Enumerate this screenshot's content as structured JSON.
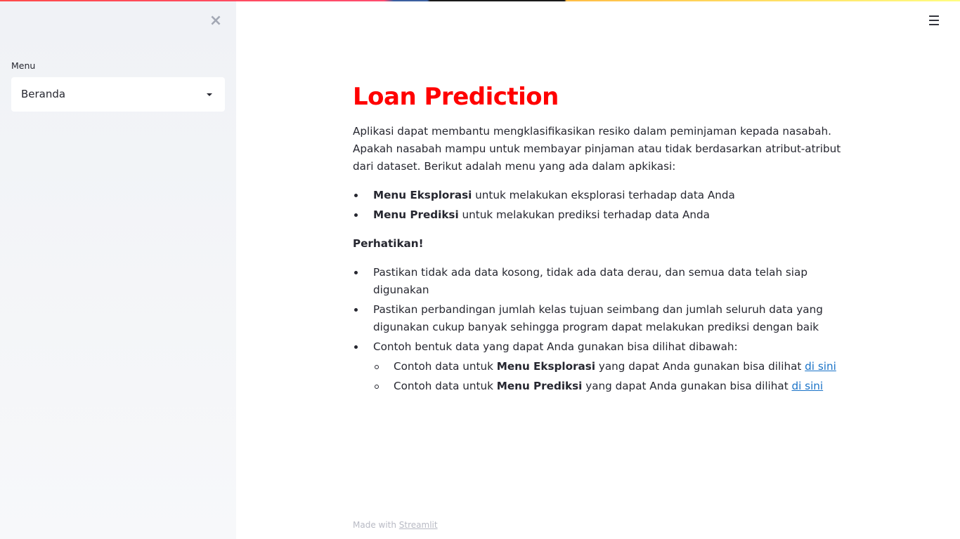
{
  "sidebar": {
    "close_glyph": "×",
    "menu_label": "Menu",
    "select_value": "Beranda"
  },
  "header": {
    "menu_glyph": "☰"
  },
  "main": {
    "title": "Loan Prediction",
    "intro": "Aplikasi dapat membantu mengklasifikasikan resiko dalam peminjaman kepada nasabah. Apakah nasabah mampu untuk membayar pinjaman atau tidak berdasarkan atribut-atribut dari dataset. Berikut adalah menu yang ada dalam apkikasi:",
    "menu_items": [
      {
        "bold": "Menu Eksplorasi",
        "text": " untuk melakukan eksplorasi terhadap data Anda"
      },
      {
        "bold": "Menu Prediksi",
        "text": " untuk melakukan prediksi terhadap data Anda"
      }
    ],
    "warning_heading": "Perhatikan!",
    "warnings": [
      "Pastikan tidak ada data kosong, tidak ada data derau, dan semua data telah siap digunakan",
      "Pastikan perbandingan jumlah kelas tujuan seimbang dan jumlah seluruh data yang digunakan cukup banyak sehingga program dapat melakukan prediksi dengan baik",
      "Contoh bentuk data yang dapat Anda gunakan bisa dilihat dibawah:"
    ],
    "examples": [
      {
        "prefix": "Contoh data untuk ",
        "bold": "Menu Eksplorasi",
        "suffix": " yang dapat Anda gunakan bisa dilihat ",
        "link": "di sini"
      },
      {
        "prefix": "Contoh data untuk ",
        "bold": "Menu Prediksi",
        "suffix": " yang dapat Anda gunakan bisa dilihat ",
        "link": "di sini"
      }
    ]
  },
  "footer": {
    "made_with": "Made with ",
    "link": "Streamlit"
  },
  "colors": {
    "title": "#ff0000",
    "link": "#1a73c8",
    "sidebar_bg": "#f0f2f6",
    "text": "#262730"
  }
}
